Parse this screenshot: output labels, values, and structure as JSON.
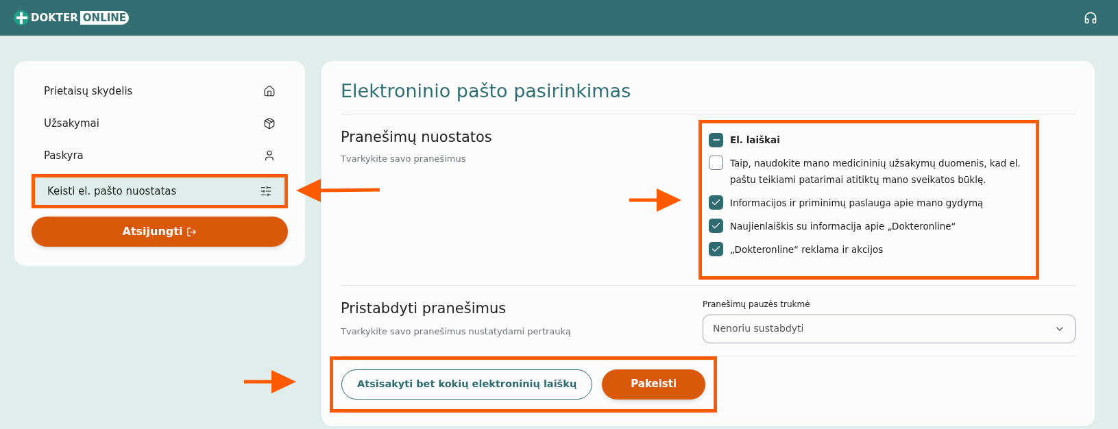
{
  "header": {
    "logo_word": "DOKTER",
    "logo_badge": "ONLINE"
  },
  "sidebar": {
    "items": [
      {
        "label": "Prietaisų skydelis",
        "selected": false
      },
      {
        "label": "Užsakymai",
        "selected": false
      },
      {
        "label": "Paskyra",
        "selected": false
      },
      {
        "label": "Keisti el. pašto nuostatas",
        "selected": true
      }
    ],
    "logout": "Atsijungti"
  },
  "main": {
    "title": "Elektroninio pašto pasirinkimas",
    "notifications": {
      "heading": "Pranešimų nuostatos",
      "subtitle": "Tvarkykite savo pranešimus",
      "group": {
        "label": "El. laiškai",
        "indeterminate": true
      },
      "options": [
        {
          "label": "Taip, naudokite mano medicininių užsakymų duomenis, kad el. paštu teikiami patarimai atitiktų mano sveikatos būklę.",
          "checked": false
        },
        {
          "label": "Informacijos ir priminimų paslauga apie mano gydymą",
          "checked": true
        },
        {
          "label": "Naujienlaiškis su informacija apie „Dokteronline“",
          "checked": true
        },
        {
          "label": "„Dokteronline“ reklama ir akcijos",
          "checked": true
        }
      ]
    },
    "pause": {
      "heading": "Pristabdyti pranešimus",
      "subtitle": "Tvarkykite savo pranešimus nustatydami pertrauką",
      "field_label": "Pranešimų pauzės trukmė",
      "value": "Nenoriu sustabdyti"
    },
    "buttons": {
      "unsubscribe": "Atsisakyti bet kokių elektroninių laiškų",
      "save": "Pakeisti"
    }
  }
}
